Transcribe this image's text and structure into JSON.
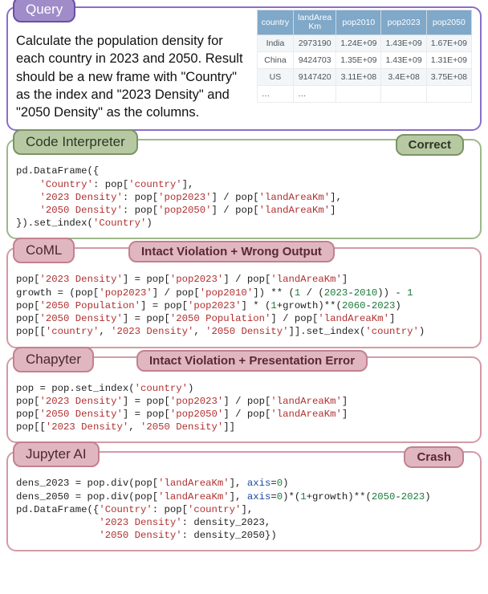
{
  "query": {
    "title": "Query",
    "text": "Calculate the population density for each country in 2023 and 2050. Result should be a new frame with \"Country\" as the index and \"2023 Density\" and \"2050 Density\" as the columns.",
    "table": {
      "headers": [
        "country",
        "landArea\nKm",
        "pop2010",
        "pop2023",
        "pop2050"
      ],
      "rows": [
        [
          "India",
          "2973190",
          "1.24E+09",
          "1.43E+09",
          "1.67E+09"
        ],
        [
          "China",
          "9424703",
          "1.35E+09",
          "1.43E+09",
          "1.31E+09"
        ],
        [
          "US",
          "9147420",
          "3.11E+08",
          "3.4E+08",
          "3.75E+08"
        ],
        [
          "…",
          "…",
          "",
          "",
          ""
        ]
      ]
    }
  },
  "sections": {
    "interpreter": {
      "title": "Code Interpreter",
      "status": "Correct"
    },
    "coml": {
      "title": "CoML",
      "status": "Intact Violation + Wrong Output"
    },
    "chapyter": {
      "title": "Chapyter",
      "status": "Intact Violation + Presentation Error"
    },
    "jupyter": {
      "title": "Jupyter AI",
      "status": "Crash"
    }
  },
  "code": {
    "interpreter_raw": "pd.DataFrame({\n    'Country': pop['country'],\n    '2023 Density': pop['pop2023'] / pop['landAreaKm'],\n    '2050 Density': pop['pop2050'] / pop['landAreaKm']\n}).set_index('Country')",
    "coml_raw": "pop['2023 Density'] = pop['pop2023'] / pop['landAreaKm']\ngrowth = (pop['pop2023'] / pop['pop2010']) ** (1 / (2023-2010)) - 1\npop['2050 Population'] = pop['pop2023'] * (1+growth)**(2060-2023)\npop['2050 Density'] = pop['2050 Population'] / pop['landAreaKm']\npop[['country', '2023 Density', '2050 Density']].set_index('country')",
    "chapyter_raw": "pop = pop.set_index('country')\npop['2023 Density'] = pop['pop2023'] / pop['landAreaKm']\npop['2050 Density'] = pop['pop2050'] / pop['landAreaKm']\npop[['2023 Density', '2050 Density']]",
    "jupyter_raw": "dens_2023 = pop.div(pop['landAreaKm'], axis=0)\ndens_2050 = pop.div(pop['landAreaKm'], axis=0)*(1+growth)**(2050-2023)\npd.DataFrame({'Country': pop['country'],\n              '2023 Density': density_2023,\n              '2050 Density': density_2050})"
  }
}
